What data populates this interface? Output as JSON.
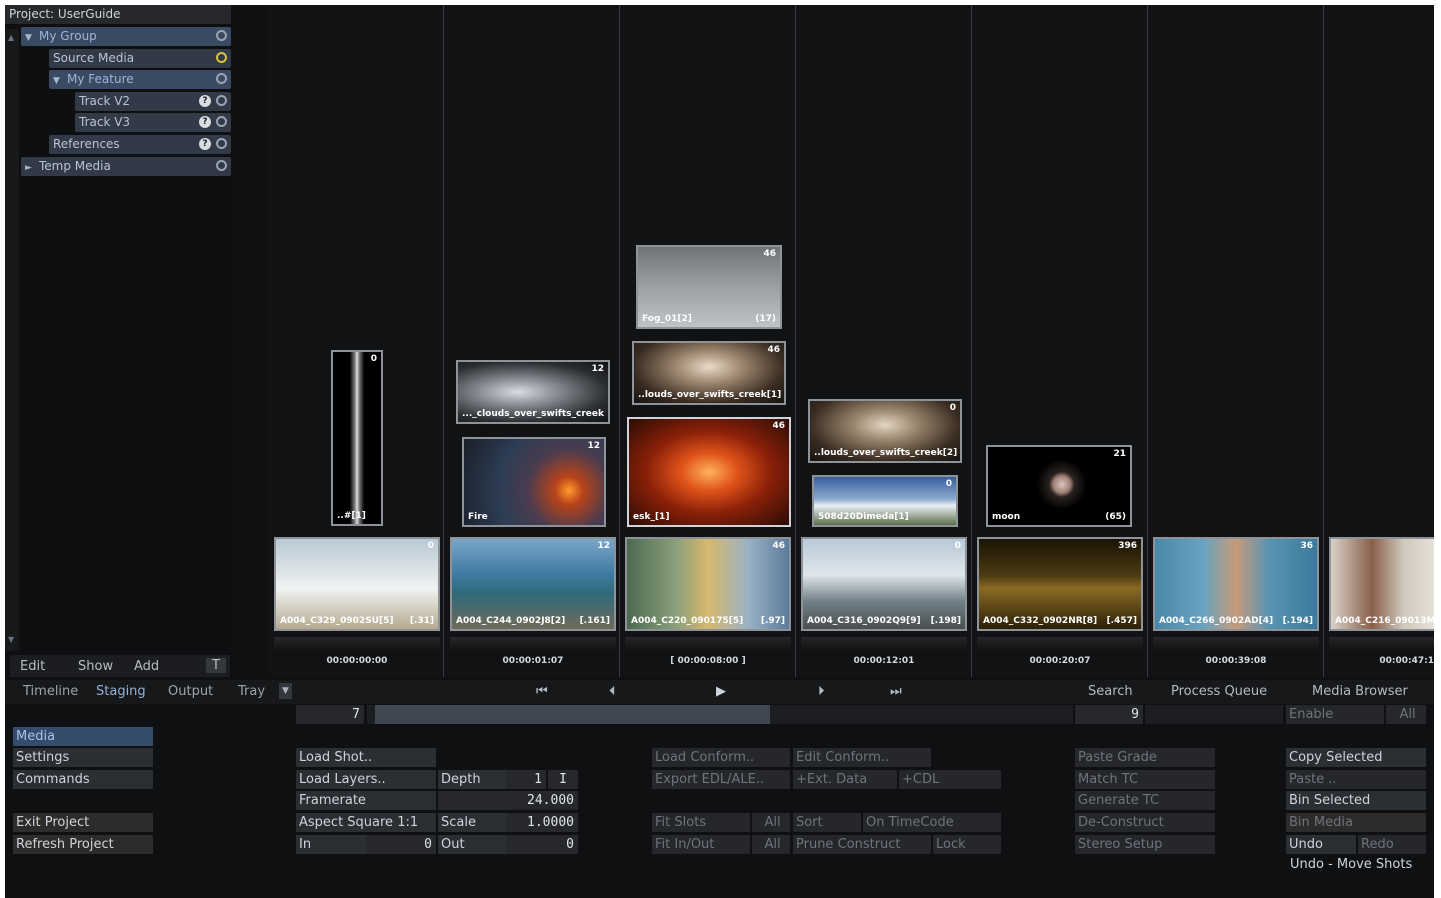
{
  "project": {
    "label": "Project: UserGuide"
  },
  "tree": [
    {
      "label": "My Group",
      "arrow": "▼"
    },
    {
      "label": "Source Media",
      "arrow": ""
    },
    {
      "label": "My Feature",
      "arrow": "▼"
    },
    {
      "label": "Track V2",
      "arrow": ""
    },
    {
      "label": "Track V3",
      "arrow": ""
    },
    {
      "label": "References",
      "arrow": ""
    },
    {
      "label": "Temp Media",
      "arrow": "►"
    }
  ],
  "left_toolbar": {
    "edit": "Edit",
    "show": "Show",
    "add": "Add",
    "t": "T"
  },
  "shots": [
    {
      "caption": "A004_C329_0902SU[5]",
      "count": "[.31]",
      "num": "0",
      "tc": "00:00:00:00"
    },
    {
      "caption": "A004_C244_0902J8[2]",
      "count": "[.161]",
      "num": "12",
      "tc": "00:00:01:07"
    },
    {
      "caption": "A004_C220_090175[5]",
      "count": "[.97]",
      "num": "46",
      "tc": "[ 00:00:08:00 ]"
    },
    {
      "caption": "A004_C316_0902Q9[9]",
      "count": "[.198]",
      "num": "0",
      "tc": "00:00:12:01"
    },
    {
      "caption": "A004_C332_0902NR[8]",
      "count": "[.457]",
      "num": "396",
      "tc": "00:00:20:07"
    },
    {
      "caption": "A004_C266_0902AD[4]",
      "count": "[.194]",
      "num": "36",
      "tc": "00:00:39:08"
    },
    {
      "caption": "A004_C216_09013M[",
      "count": "",
      "num": "",
      "tc": "00:00:47:1"
    }
  ],
  "layers": {
    "strip": {
      "caption": "..#[1]",
      "num": "0"
    },
    "clouds1": {
      "caption": "..._clouds_over_swifts_creek",
      "num": "12"
    },
    "fire": {
      "caption": "Fire",
      "num": "12"
    },
    "fog": {
      "caption": "Fog_01[2]",
      "count": "(17)",
      "num": "46"
    },
    "clouds2": {
      "caption": "..louds_over_swifts_creek[1]",
      "num": "46"
    },
    "dusk": {
      "caption": "esk_[1]",
      "num": "46"
    },
    "clouds3": {
      "caption": "..louds_over_swifts_creek[2]",
      "num": "0"
    },
    "sky": {
      "caption": "508d20Dimeda[1]",
      "num": "0"
    },
    "moon": {
      "caption": "moon",
      "count": "(65)",
      "num": "21"
    }
  },
  "tabs": {
    "timeline": "Timeline",
    "staging": "Staging",
    "output": "Output",
    "tray": "Tray"
  },
  "transport": {
    "search": "Search",
    "queue": "Process Queue",
    "browser": "Media Browser",
    "left_num": "7",
    "right_num": "9"
  },
  "side_menu": {
    "media": "Media",
    "settings": "Settings",
    "commands": "Commands",
    "exit": "Exit Project",
    "refresh": "Refresh Project"
  },
  "load": {
    "load_shot": "Load Shot..",
    "load_layers": "Load Layers..",
    "framerate": "Framerate",
    "aspect": "Aspect Square 1:1",
    "in_label": "In",
    "in_val": "0",
    "depth_label": "Depth",
    "depth_val": "1",
    "depth_extra": "I",
    "fps_val": "24.000",
    "scale_label": "Scale",
    "scale_val": "1.0000",
    "out_label": "Out",
    "out_val": "0"
  },
  "conform": {
    "load_conform": "Load Conform..",
    "edit_conform": "Edit Conform..",
    "export_edl": "Export EDL/ALE..",
    "ext_data": "+Ext. Data",
    "cdl": "+CDL",
    "fit_slots": "Fit Slots",
    "fit_all": "All",
    "sort": "Sort",
    "on_tc": "On TimeCode",
    "fit_inout": "Fit In/Out",
    "inout_all": "All",
    "prune": "Prune Construct",
    "lock": "Lock"
  },
  "grade": {
    "paste_grade": "Paste Grade",
    "match_tc": "Match TC",
    "gen_tc": "Generate TC",
    "deconstruct": "De-Construct",
    "stereo": "Stereo Setup"
  },
  "browser_panel": {
    "enable": "Enable",
    "enable_all": "All",
    "copy_sel": "Copy Selected",
    "paste": "Paste ..",
    "bin_sel": "Bin Selected",
    "bin_media": "Bin Media",
    "undo": "Undo",
    "redo": "Redo",
    "undo_status": "Undo - Move Shots"
  },
  "colors": {
    "accent": "#8fb2dc",
    "panel": "#2b2e33",
    "bg": "#0f1011"
  }
}
